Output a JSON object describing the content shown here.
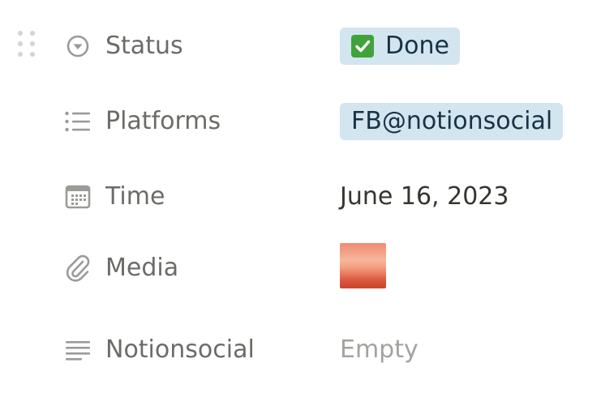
{
  "properties": [
    {
      "key": "status",
      "icon": "status-circle-icon",
      "name": "Status",
      "value": "Done",
      "emoji": "check-mark-button-emoji"
    },
    {
      "key": "platforms",
      "icon": "bulleted-list-icon",
      "name": "Platforms",
      "value": "FB@notionsocial"
    },
    {
      "key": "time",
      "icon": "calendar-icon",
      "name": "Time",
      "value": "June 16, 2023"
    },
    {
      "key": "media",
      "icon": "paperclip-icon",
      "name": "Media",
      "value": "media-thumbnail-image"
    },
    {
      "key": "notionsocial",
      "icon": "text-lines-icon",
      "name": "Notionsocial",
      "value": "Empty"
    }
  ],
  "colors": {
    "label": "#6b6b68",
    "icon": "#9b9a97",
    "tag_bg": "#d3e5ef",
    "tag_text": "#183347",
    "value_text": "#37352f",
    "empty_text": "#a3a29e",
    "check_green": "#3fa33a"
  }
}
